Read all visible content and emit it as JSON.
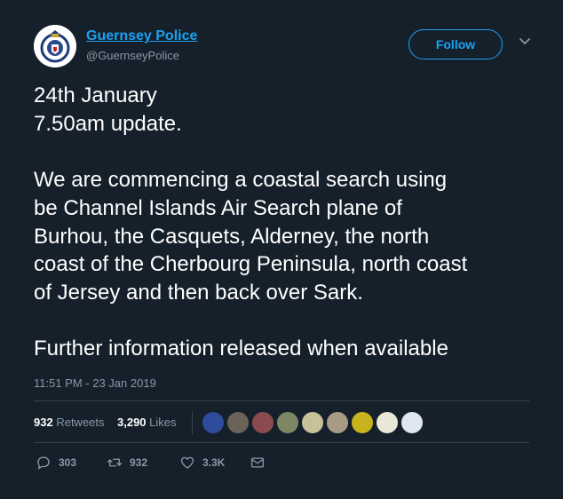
{
  "account": {
    "name": "Guernsey Police",
    "handle": "@GuernseyPolice",
    "follow_label": "Follow"
  },
  "tweet": {
    "lines": [
      "24th January",
      "7.50am update.",
      "",
      "We are commencing a coastal search using",
      "be Channel Islands Air Search plane of",
      "Burhou, the Casquets, Alderney, the north",
      "coast of the Cherbourg Peninsula, north coast",
      "of Jersey and then back over Sark.",
      "",
      "Further information released when available"
    ],
    "timestamp": "11:51 PM - 23 Jan 2019"
  },
  "stats": {
    "retweets_count": "932",
    "retweets_label": "Retweets",
    "likes_count": "3,290",
    "likes_label": "Likes"
  },
  "actions": {
    "replies": "303",
    "retweets": "932",
    "likes": "3.3K"
  },
  "icons": {
    "reply": "reply-icon",
    "retweet": "retweet-icon",
    "like": "heart-icon",
    "message": "envelope-icon",
    "more": "chevron-down-icon"
  },
  "colors": {
    "background": "#15202b",
    "accent": "#1da1f2",
    "muted": "#8899a6"
  }
}
